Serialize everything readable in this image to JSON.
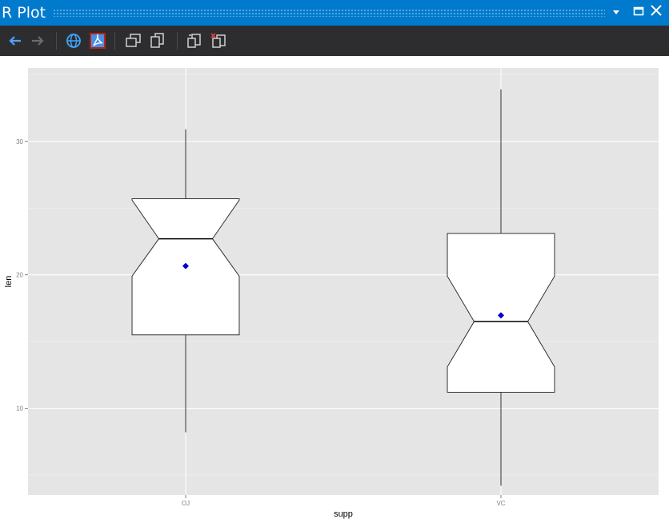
{
  "window": {
    "title": "R Plot",
    "controls": [
      "dropdown-icon",
      "maximize-icon",
      "close-icon"
    ]
  },
  "toolbar": {
    "buttons": [
      "back-arrow-icon",
      "forward-arrow-icon",
      "globe-icon",
      "pdf-icon",
      "copy-window-icon",
      "copy-page-icon",
      "export-icon",
      "remove-plot-icon"
    ]
  },
  "colors": {
    "titlebar": "#007acc",
    "toolbar": "#2d2d30",
    "panel": "#e5e5e5",
    "mean_marker": "#0000cc"
  },
  "chart_data": {
    "type": "boxplot",
    "xlabel": "supp",
    "ylabel": "len",
    "categories": [
      "OJ",
      "VC"
    ],
    "ylim": [
      3.5,
      35.5
    ],
    "yticks": [
      10,
      20,
      30
    ],
    "grid": true,
    "boxes": [
      {
        "category": "OJ",
        "whisker_low": 8.2,
        "q1": 15.5,
        "median": 22.7,
        "q3": 25.7,
        "whisker_high": 30.9,
        "notch_low": 19.9,
        "notch_high": 25.6,
        "mean": 20.66
      },
      {
        "category": "VC",
        "whisker_low": 4.2,
        "q1": 11.2,
        "median": 16.5,
        "q3": 23.1,
        "whisker_high": 33.9,
        "notch_low": 13.1,
        "notch_high": 19.9,
        "mean": 16.96
      }
    ]
  }
}
